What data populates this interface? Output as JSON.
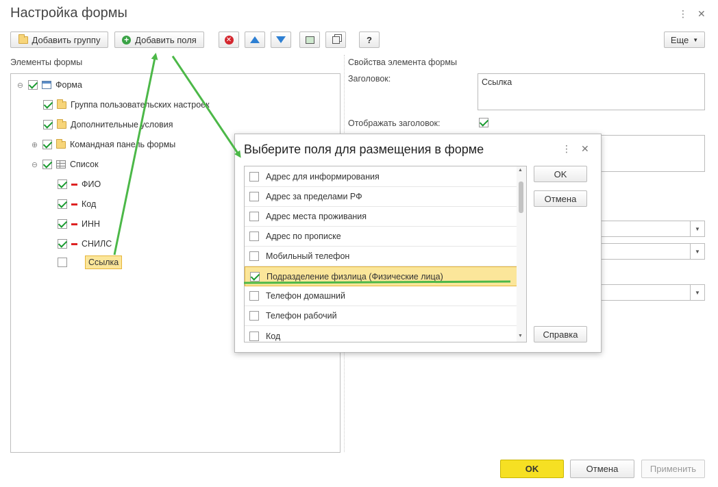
{
  "window": {
    "title": "Настройка формы",
    "more_icon": "⋮",
    "close_icon": "✕"
  },
  "toolbar": {
    "add_group": "Добавить группу",
    "add_fields": "Добавить поля",
    "help": "?",
    "more": "Еще"
  },
  "tree": {
    "header": "Элементы формы",
    "items": [
      {
        "label": "Форма",
        "checked": true
      },
      {
        "label": "Группа пользовательских настроек",
        "checked": true
      },
      {
        "label": "Дополнительные условия",
        "checked": true
      },
      {
        "label": "Командная панель формы",
        "checked": true
      },
      {
        "label": "Список",
        "checked": true
      },
      {
        "label": "ФИО",
        "checked": true
      },
      {
        "label": "Код",
        "checked": true
      },
      {
        "label": "ИНН",
        "checked": true
      },
      {
        "label": "СНИЛС",
        "checked": true
      },
      {
        "label": "Ссылка",
        "checked": false
      }
    ]
  },
  "properties": {
    "header": "Свойства элемента формы",
    "caption_label": "Заголовок:",
    "caption_value": "Ссылка",
    "show_caption_label": "Отображать заголовок:",
    "show_caption_checked": true
  },
  "dialog": {
    "title": "Выберите поля для размещения в форме",
    "more_icon": "⋮",
    "close_icon": "✕",
    "items": [
      {
        "label": "Адрес для информирования",
        "checked": false
      },
      {
        "label": "Адрес за пределами РФ",
        "checked": false
      },
      {
        "label": "Адрес места проживания",
        "checked": false
      },
      {
        "label": "Адрес по прописке",
        "checked": false
      },
      {
        "label": "Мобильный телефон",
        "checked": false
      },
      {
        "label": "Подразделение физлица (Физические лица)",
        "checked": true
      },
      {
        "label": "Телефон домашний",
        "checked": false
      },
      {
        "label": "Телефон рабочий",
        "checked": false
      },
      {
        "label": "Код",
        "checked": false
      }
    ],
    "ok": "OK",
    "cancel": "Отмена",
    "help": "Справка"
  },
  "footer": {
    "ok": "OK",
    "cancel": "Отмена",
    "apply": "Применить"
  },
  "colors": {
    "accent_yellow": "#f6e023",
    "highlight": "#fbe69a",
    "arrow_green": "#4cb848"
  }
}
